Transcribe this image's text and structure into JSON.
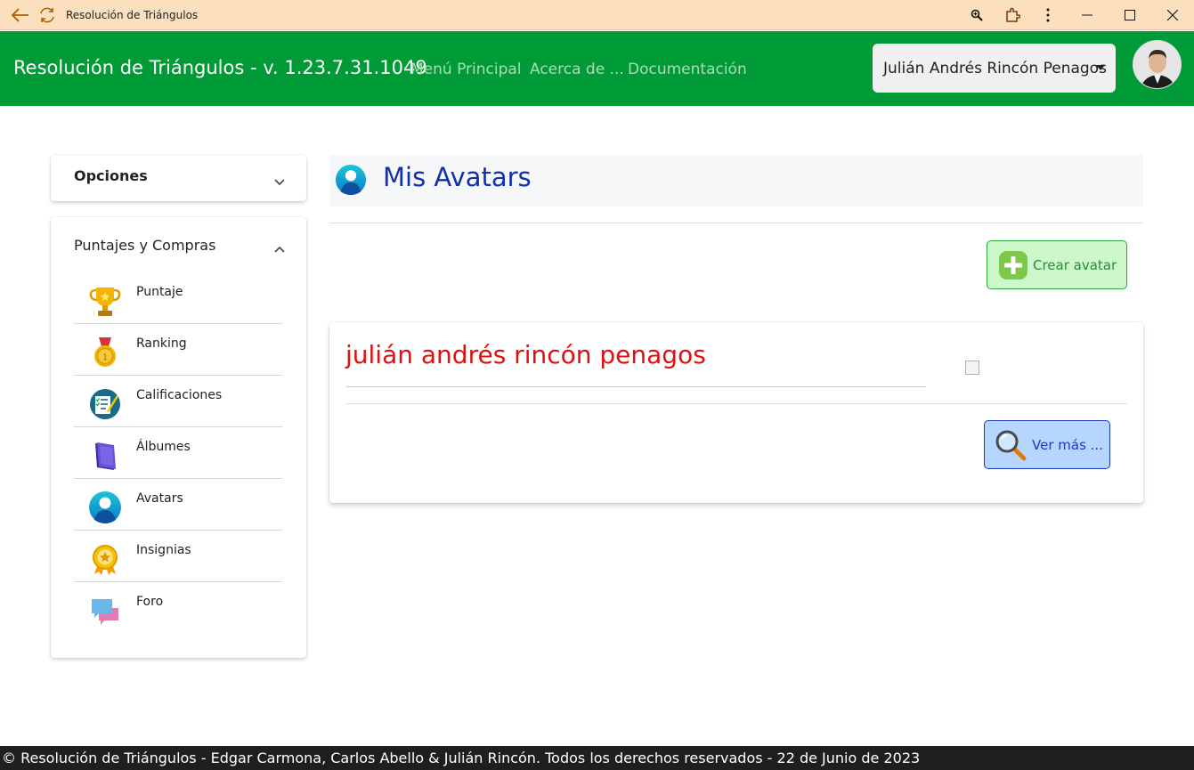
{
  "window": {
    "title": "Resolución de Triángulos"
  },
  "header": {
    "brand": "Resolución de Triángulos - v. 1.23.7.31.1049",
    "nav": [
      "Menú Principal",
      "Acerca de ...",
      "Documentación"
    ],
    "user": "Julián Andrés Rincón Penagos"
  },
  "sidebar": {
    "options_title": "Opciones",
    "section_title": "Puntajes y Compras",
    "items": [
      {
        "label": "Puntaje",
        "icon": "trophy-icon"
      },
      {
        "label": "Ranking",
        "icon": "medal-icon"
      },
      {
        "label": "Calificaciones",
        "icon": "grades-icon"
      },
      {
        "label": "Álbumes",
        "icon": "album-icon"
      },
      {
        "label": "Avatars",
        "icon": "avatar-icon"
      },
      {
        "label": "Insignias",
        "icon": "badge-icon"
      },
      {
        "label": "Foro",
        "icon": "forum-icon"
      }
    ]
  },
  "main": {
    "title": "Mis Avatars",
    "create_label": "Crear avatar",
    "avatar_name": "julián andrés rincón penagos",
    "view_more_label": "Ver más ..."
  },
  "footer": {
    "text": "© Resolución de Triángulos - Edgar Carmona, Carlos Abello & Julián Rincón. Todos los derechos reservados - 22 de Junio de 2023"
  },
  "colors": {
    "titlebar": "#fcdfbd",
    "appbar": "#009a36",
    "title_blue": "#1030b0",
    "avatar_name_red": "#e01010",
    "footer": "#1f1f1f"
  }
}
